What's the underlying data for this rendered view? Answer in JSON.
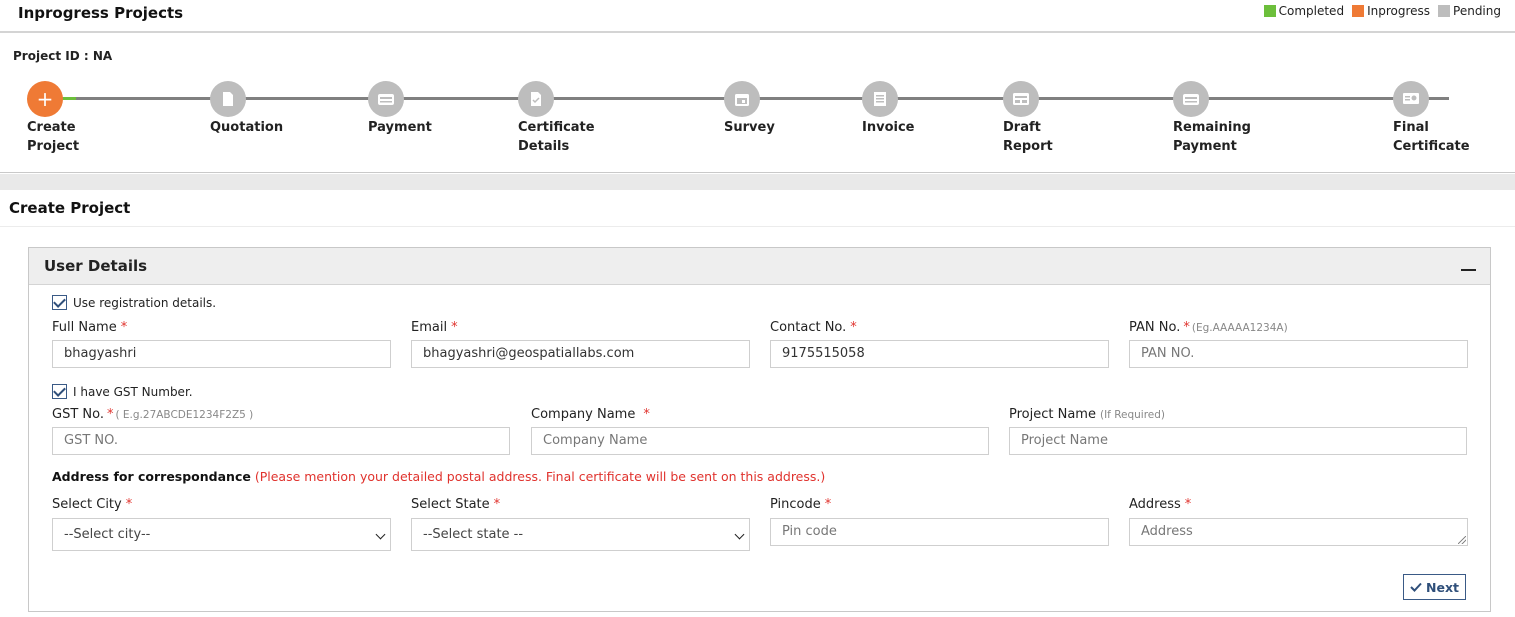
{
  "header": {
    "title": "Inprogress Projects",
    "legend": [
      {
        "label": "Completed",
        "color": "#6cbf3b"
      },
      {
        "label": "Inprogress",
        "color": "#ef7a35"
      },
      {
        "label": "Pending",
        "color": "#bdbdbd"
      }
    ]
  },
  "project": {
    "id_label": "Project ID : NA"
  },
  "steps": [
    {
      "label": "Create\nProject",
      "icon": "plus-icon",
      "status": "inprogress"
    },
    {
      "label": "Quotation",
      "icon": "document-icon",
      "status": "pending"
    },
    {
      "label": "Payment",
      "icon": "wallet-icon",
      "status": "pending"
    },
    {
      "label": "Certificate\nDetails",
      "icon": "file-check-icon",
      "status": "pending"
    },
    {
      "label": "Survey",
      "icon": "calendar-icon",
      "status": "pending"
    },
    {
      "label": "Invoice",
      "icon": "invoice-icon",
      "status": "pending"
    },
    {
      "label": "Draft\nReport",
      "icon": "report-icon",
      "status": "pending"
    },
    {
      "label": "Remaining\nPayment",
      "icon": "wallet-icon",
      "status": "pending"
    },
    {
      "label": "Final\nCertificate",
      "icon": "certificate-icon",
      "status": "pending"
    }
  ],
  "section": {
    "title": "Create Project"
  },
  "card": {
    "title": "User Details",
    "use_registration": "Use registration details.",
    "gst_check": "I have GST Number."
  },
  "fields": {
    "full_name": {
      "label": "Full Name",
      "value": "bhagyashri"
    },
    "email": {
      "label": "Email",
      "value": "bhagyashri@geospatiallabs.com"
    },
    "contact": {
      "label": "Contact No.",
      "value": "9175515058"
    },
    "pan": {
      "label": "PAN No.",
      "hint": "(Eg.AAAAA1234A)",
      "placeholder": "PAN NO."
    },
    "gst": {
      "label": "GST No.",
      "hint": "( E.g.27ABCDE1234F2Z5 )",
      "placeholder": "GST NO."
    },
    "company": {
      "label": "Company Name",
      "placeholder": "Company Name"
    },
    "project_name": {
      "label": "Project Name",
      "hint": "(If Required)",
      "placeholder": "Project Name"
    },
    "city": {
      "label": "Select City",
      "value": "--Select city--"
    },
    "state": {
      "label": "Select State",
      "value": "--Select state --"
    },
    "pincode": {
      "label": "Pincode",
      "placeholder": "Pin code"
    },
    "address": {
      "label": "Address",
      "placeholder": "Address"
    }
  },
  "address_note": {
    "bold": "Address for correspondance",
    "red": "(Please mention your detailed postal address. Final certificate will be sent on this address.)"
  },
  "next_button": "Next",
  "required_mark": "*"
}
